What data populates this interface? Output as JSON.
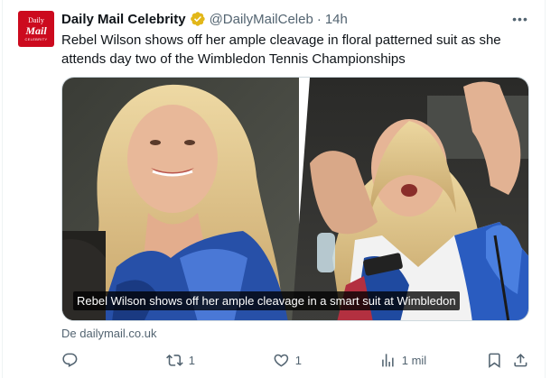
{
  "avatar": {
    "line1": "Daily",
    "line2": "Mail",
    "line3": "CELEBRITY"
  },
  "author": {
    "name": "Daily Mail Celebrity",
    "handle": "@DailyMailCeleb",
    "separator": "·",
    "time": "14h"
  },
  "more_label": "•••",
  "tweet": {
    "text": "Rebel Wilson shows off her ample cleavage in floral patterned suit as she attends day two of the Wimbledon Tennis Championships"
  },
  "media": {
    "caption": "Rebel Wilson shows off her ample cleavage in a smart suit at Wimbledon"
  },
  "source": "De dailymail.co.uk",
  "actions": {
    "reply_count": "",
    "retweet_count": "1",
    "like_count": "1",
    "views_count": "1 mil"
  },
  "colors": {
    "brand_red": "#cc0a1e",
    "verified_gold": "#e2b719",
    "secondary_text": "#536471"
  }
}
